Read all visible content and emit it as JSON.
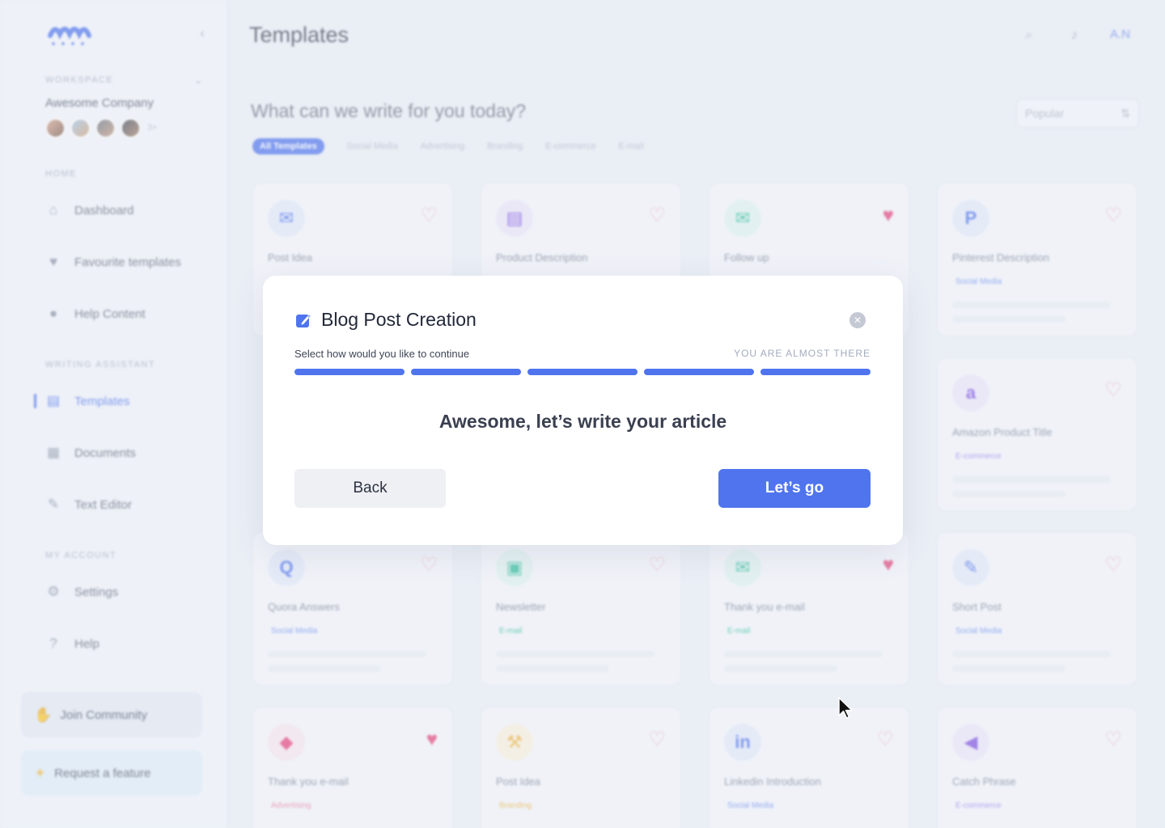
{
  "sidebar": {
    "workspace_label": "WORKSPACE",
    "company_name": "Awesome Company",
    "avatar_more": "3+",
    "home_label": "HOME",
    "home_items": [
      {
        "label": "Dashboard",
        "icon": "home-icon"
      },
      {
        "label": "Favourite templates",
        "icon": "heart-icon"
      },
      {
        "label": "Help Content",
        "icon": "bulb-icon"
      }
    ],
    "writing_label": "WRITING ASSISTANT",
    "writing_items": [
      {
        "label": "Templates",
        "icon": "templates-icon",
        "active": true
      },
      {
        "label": "Documents",
        "icon": "documents-icon"
      },
      {
        "label": "Text Editor",
        "icon": "pencil-icon"
      }
    ],
    "account_label": "MY ACCOUNT",
    "account_items": [
      {
        "label": "Settings",
        "icon": "gear-icon"
      },
      {
        "label": "Help",
        "icon": "help-icon"
      }
    ],
    "join_community": "Join Community",
    "request_feature": "Request a feature"
  },
  "header": {
    "title": "Templates",
    "user_initials": "A.N"
  },
  "main": {
    "subtitle": "What can we write for you today?",
    "sort_value": "Popular",
    "filters": [
      "All Templates",
      "Social Media",
      "Advertising",
      "Branding",
      "E-commerce",
      "E-mail"
    ],
    "cards": [
      {
        "title": "Post Idea",
        "tag": "",
        "icon": "mail-icon",
        "favorite": false
      },
      {
        "title": "Product Description",
        "tag": "",
        "icon": "document-icon",
        "favorite": false
      },
      {
        "title": "Follow up",
        "tag": "",
        "icon": "mail-open-icon",
        "favorite": true
      },
      {
        "title": "Pinterest Description",
        "tag": "Social Media",
        "icon": "pinterest-icon",
        "favorite": false
      },
      {
        "title": "Amazon Product Title",
        "tag": "E-commerce",
        "icon": "amazon-icon",
        "favorite": false
      },
      {
        "title": "Quora Answers",
        "tag": "Social Media",
        "icon": "quora-icon",
        "favorite": false
      },
      {
        "title": "Newsletter",
        "tag": "E-mail",
        "icon": "newsletter-icon",
        "favorite": false
      },
      {
        "title": "Thank you e-mail",
        "tag": "E-mail",
        "icon": "mail-send-icon",
        "favorite": true
      },
      {
        "title": "Short Post",
        "tag": "Social Media",
        "icon": "edit-icon",
        "favorite": false
      },
      {
        "title": "Thank you e-mail",
        "tag": "Advertising",
        "icon": "gem-icon",
        "favorite": true
      },
      {
        "title": "Post Idea",
        "tag": "Branding",
        "icon": "hammer-icon",
        "favorite": false
      },
      {
        "title": "Linkedin Introduction",
        "tag": "Social Media",
        "icon": "linkedin-icon",
        "favorite": false
      },
      {
        "title": "Catch Phrase",
        "tag": "E-commerce",
        "icon": "megaphone-icon",
        "favorite": false
      }
    ]
  },
  "modal": {
    "title": "Blog Post Creation",
    "step_label": "Select how would you like to continue",
    "step_hint": "YOU ARE ALMOST THERE",
    "progress_completed": 5,
    "progress_total": 5,
    "heading": "Awesome, let’s write your article",
    "back_label": "Back",
    "go_label": "Let’s go"
  },
  "colors": {
    "accent": "#4f74ee",
    "heart": "#e9437a",
    "background": "#eef1f7"
  }
}
